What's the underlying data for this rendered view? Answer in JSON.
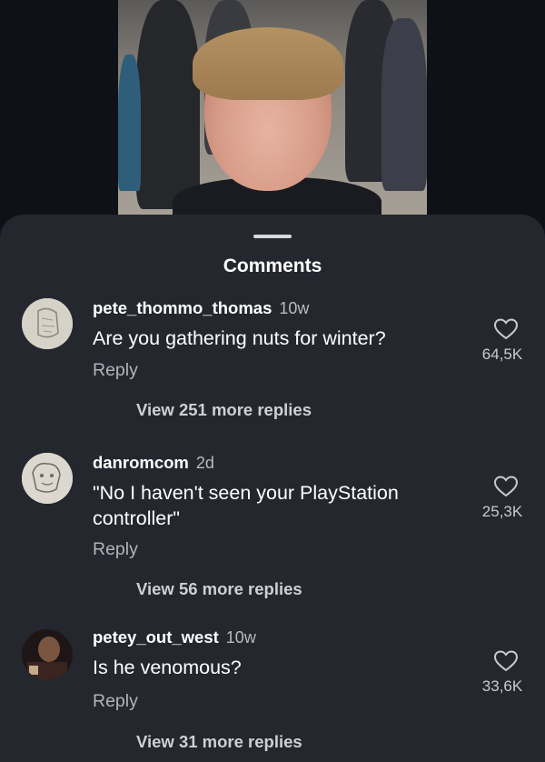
{
  "sheet": {
    "title": "Comments"
  },
  "comments": [
    {
      "username": "pete_thommo_thomas",
      "time": "10w",
      "text": "Are you gathering nuts for winter?",
      "reply_label": "Reply",
      "view_replies": "View 251 more replies",
      "likes": "64,5K"
    },
    {
      "username": "danromcom",
      "time": "2d",
      "text": "\"No I haven't seen your PlayStation controller\"",
      "reply_label": "Reply",
      "view_replies": "View 56 more replies",
      "likes": "25,3K"
    },
    {
      "username": "petey_out_west",
      "time": "10w",
      "text": "Is he venomous?",
      "reply_label": "Reply",
      "view_replies": "View 31 more replies",
      "likes": "33,6K"
    }
  ],
  "icons": {
    "like": "heart-outline-icon"
  },
  "colors": {
    "background": "#10141c",
    "sheet": "#25272f",
    "text": "#ffffff",
    "muted": "#b3b4bb"
  }
}
